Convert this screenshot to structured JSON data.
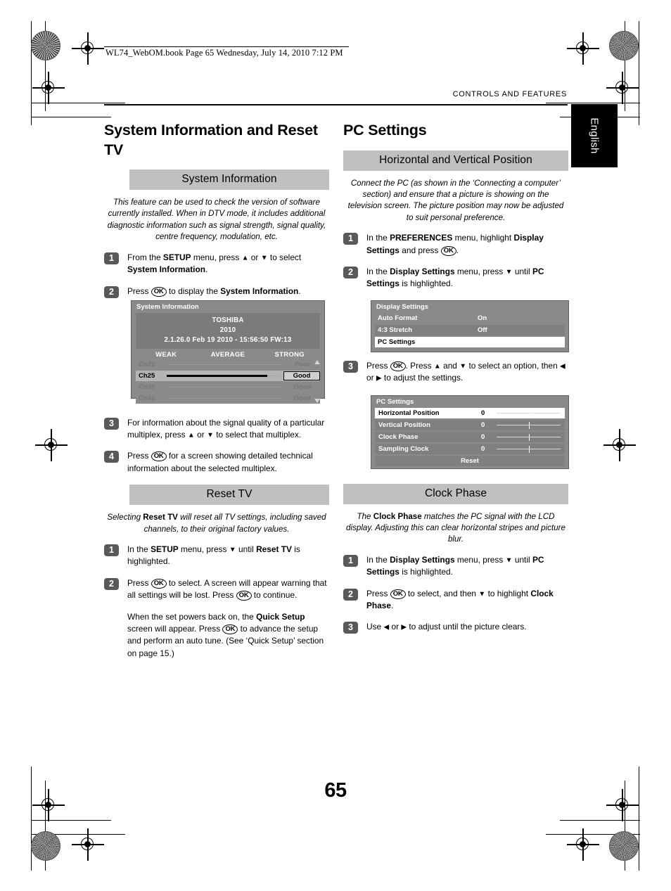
{
  "print_marks": {
    "file_stamp": "WL74_WebOM.book  Page 65  Wednesday, July 14, 2010  7:12 PM"
  },
  "running_head": "CONTROLS AND FEATURES",
  "language_tab": "English",
  "page_number": "65",
  "left_column": {
    "chapter_title": "System Information and Reset TV",
    "sections": [
      {
        "heading": "System Information",
        "blurb": "This feature can be used to check the version of software currently installed. When in DTV mode, it includes additional diagnostic information such as signal strength, signal quality, centre frequency, modulation, etc.",
        "steps": [
          {
            "n": "1",
            "text_html": "From the <b>SETUP</b> menu, press <span class=\"arr\">▲</span> or <span class=\"arr\">▼</span> to select <b>System Information</b>."
          },
          {
            "n": "2",
            "text_html": "Press <span class=\"ok\">OK</span> to display the <b>System Information</b>."
          },
          {
            "n": "3",
            "text_html": "For information about the signal quality of a particular multiplex, press <span class=\"arr\">▲</span> or <span class=\"arr\">▼</span> to select that multiplex."
          },
          {
            "n": "4",
            "text_html": "Press <span class=\"ok\">OK</span> for a screen showing detailed technical information about the selected multiplex."
          }
        ]
      },
      {
        "heading": "Reset TV",
        "blurb_html": "Selecting <b>Reset TV</b> will reset all TV settings, including saved channels, to their original factory values.",
        "steps": [
          {
            "n": "1",
            "text_html": "In the <b>SETUP</b> menu, press <span class=\"arr\">▼</span> until <b>Reset TV</b> is highlighted."
          },
          {
            "n": "2",
            "text_html": "Press <span class=\"ok\">OK</span> to select. A screen will appear warning that all settings will be lost. Press <span class=\"ok\">OK</span> to continue."
          }
        ],
        "continuation_html": "When the set powers back on, the <b>Quick Setup</b> screen will appear. Press <span class=\"ok\">OK</span> to advance the setup and perform an auto tune. (See ‘Quick Setup’ section on page 15.)"
      }
    ]
  },
  "right_column": {
    "chapter_title": "PC Settings",
    "sections": [
      {
        "heading": "Horizontal and Vertical Position",
        "blurb": "Connect the PC (as shown in the ‘Connecting a computer’ section) and ensure that a picture is showing on the television screen. The picture position may now be adjusted to suit personal preference.",
        "steps": [
          {
            "n": "1",
            "text_html": "In the <b>PREFERENCES</b> menu, highlight <b>Display Settings</b> and press <span class=\"ok\">OK</span>."
          },
          {
            "n": "2",
            "text_html": "In the <b>Display Settings</b> menu, press <span class=\"arr\">▼</span> until <b>PC Settings</b> is highlighted."
          },
          {
            "n": "3",
            "text_html": "Press <span class=\"ok\">OK</span>. Press <span class=\"arr\">▲</span> and <span class=\"arr\">▼</span> to select an option, then <span class=\"arr\">◀</span> or <span class=\"arr\">▶</span> to adjust the settings."
          }
        ]
      },
      {
        "heading": "Clock Phase",
        "blurb_html": "The <b>Clock Phase</b> matches the PC signal with the LCD display. Adjusting this can clear horizontal stripes and picture blur.",
        "steps": [
          {
            "n": "1",
            "text_html": "In the <b>Display Settings</b> menu, press <span class=\"arr\">▼</span> until <b>PC Settings</b> is highlighted."
          },
          {
            "n": "2",
            "text_html": "Press <span class=\"ok\">OK</span> to select, and then <span class=\"arr\">▼</span> to highlight <b>Clock Phase</b>."
          },
          {
            "n": "3",
            "text_html": "Use <span class=\"arr\">◀</span> or <span class=\"arr\">▶</span> to adjust until the picture clears."
          }
        ]
      }
    ]
  },
  "osd_system_information": {
    "title": "System Information",
    "brand_lines": [
      "TOSHIBA",
      "2010",
      "2.1.26.0 Feb 19 2010 - 15:56:50 FW:13"
    ],
    "scale_labels": [
      "WEAK",
      "AVERAGE",
      "STRONG"
    ],
    "rows": [
      {
        "channel": "Ch22",
        "quality": "Poor",
        "level_pct": 0,
        "selected": false
      },
      {
        "channel": "Ch25",
        "quality": "Good",
        "level_pct": 88,
        "selected": true
      },
      {
        "channel": "Ch35",
        "quality": "Good",
        "level_pct": 0,
        "selected": false
      },
      {
        "channel": "Ch46",
        "quality": "Good",
        "level_pct": 0,
        "selected": false
      }
    ]
  },
  "osd_display_settings": {
    "title": "Display Settings",
    "rows": [
      {
        "label": "Auto Format",
        "value": "On",
        "highlighted": false
      },
      {
        "label": "4:3 Stretch",
        "value": "Off",
        "highlighted": false
      },
      {
        "label": "PC Settings",
        "value": "",
        "highlighted": true
      }
    ]
  },
  "osd_pc_settings": {
    "title": "PC Settings",
    "rows": [
      {
        "label": "Horizontal Position",
        "value": "0",
        "highlighted": true
      },
      {
        "label": "Vertical Position",
        "value": "0",
        "highlighted": false
      },
      {
        "label": "Clock Phase",
        "value": "0",
        "highlighted": false
      },
      {
        "label": "Sampling Clock",
        "value": "0",
        "highlighted": false
      }
    ],
    "reset_label": "Reset"
  },
  "colors": {
    "heading_bar": "#c0c0c0",
    "osd_background": "#8a8a8a",
    "badge": "#595959",
    "highlight": "#ffffff",
    "tab": "#000000"
  }
}
